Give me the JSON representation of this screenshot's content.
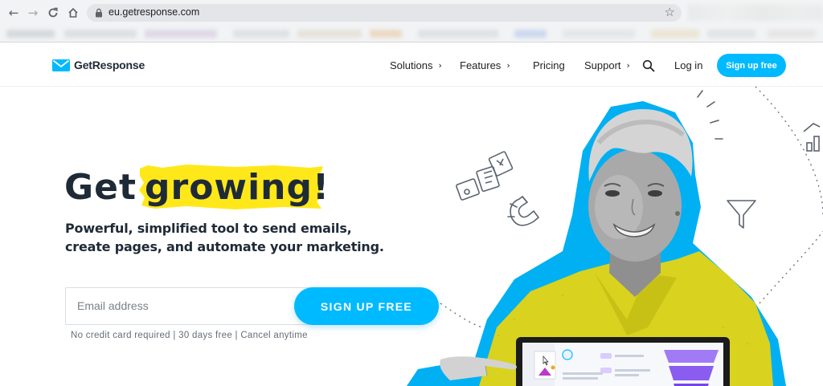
{
  "browser": {
    "url": "eu.getresponse.com"
  },
  "header": {
    "logo_text": "GetResponse",
    "nav": {
      "solutions": "Solutions",
      "features": "Features",
      "pricing": "Pricing",
      "support": "Support",
      "chevron": "›"
    },
    "login": "Log in",
    "signup": "Sign up free"
  },
  "hero": {
    "title_plain": "Get",
    "title_highlight": "growing!",
    "subtitle_line1": "Powerful, simplified tool to send emails,",
    "subtitle_line2": "create pages, and automate your marketing.",
    "email_placeholder": "Email address",
    "cta": "SIGN UP FREE",
    "fineprint": "No credit card required | 30 days free | Cancel anytime"
  },
  "colors": {
    "brand_blue": "#00baff",
    "highlight_yellow": "#ffe81a",
    "text_dark": "#1f2a37"
  },
  "icons": {
    "back": "arrow-left-icon",
    "forward": "arrow-right-icon",
    "reload": "reload-icon",
    "home": "home-icon",
    "lock": "lock-icon",
    "bookmark": "star-icon",
    "search": "search-icon"
  }
}
